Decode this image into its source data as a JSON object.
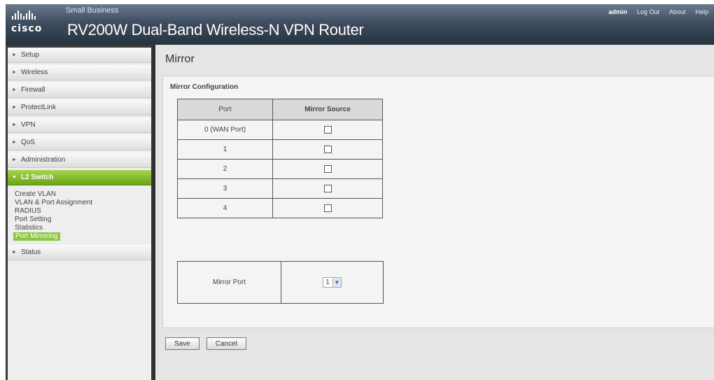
{
  "header": {
    "logo_text": "cisco",
    "brand_line": "Small Business",
    "product_title": "RV200W Dual-Band Wireless-N VPN Router",
    "user": "admin",
    "logout_label": "Log Out",
    "about_label": "About",
    "help_label": "Help"
  },
  "sidebar": {
    "items": [
      {
        "label": "Setup"
      },
      {
        "label": "Wireless"
      },
      {
        "label": "Firewall"
      },
      {
        "label": "ProtectLink"
      },
      {
        "label": "VPN"
      },
      {
        "label": "QoS"
      },
      {
        "label": "Administration"
      }
    ],
    "active_section": {
      "label": "L2 Switch"
    },
    "subitems": [
      {
        "label": "Create VLAN"
      },
      {
        "label": "VLAN & Port Assignment"
      },
      {
        "label": "RADIUS"
      },
      {
        "label": "Port Setting"
      },
      {
        "label": "Statistics"
      },
      {
        "label": "Port Mirroring"
      }
    ],
    "after_items": [
      {
        "label": "Status"
      }
    ]
  },
  "main": {
    "page_title": "Mirror",
    "section_title": "Mirror Configuration",
    "table": {
      "headers": [
        "Port",
        "Mirror Source"
      ],
      "rows": [
        {
          "port": "0 (WAN Port)",
          "checked": false
        },
        {
          "port": "1",
          "checked": false
        },
        {
          "port": "2",
          "checked": false
        },
        {
          "port": "3",
          "checked": false
        },
        {
          "port": "4",
          "checked": false
        }
      ]
    },
    "mirror_port": {
      "label": "Mirror Port",
      "value": "1"
    },
    "buttons": {
      "save": "Save",
      "cancel": "Cancel"
    }
  },
  "colors": {
    "active_nav": "#8dc63f",
    "header_dark": "#26323f"
  }
}
